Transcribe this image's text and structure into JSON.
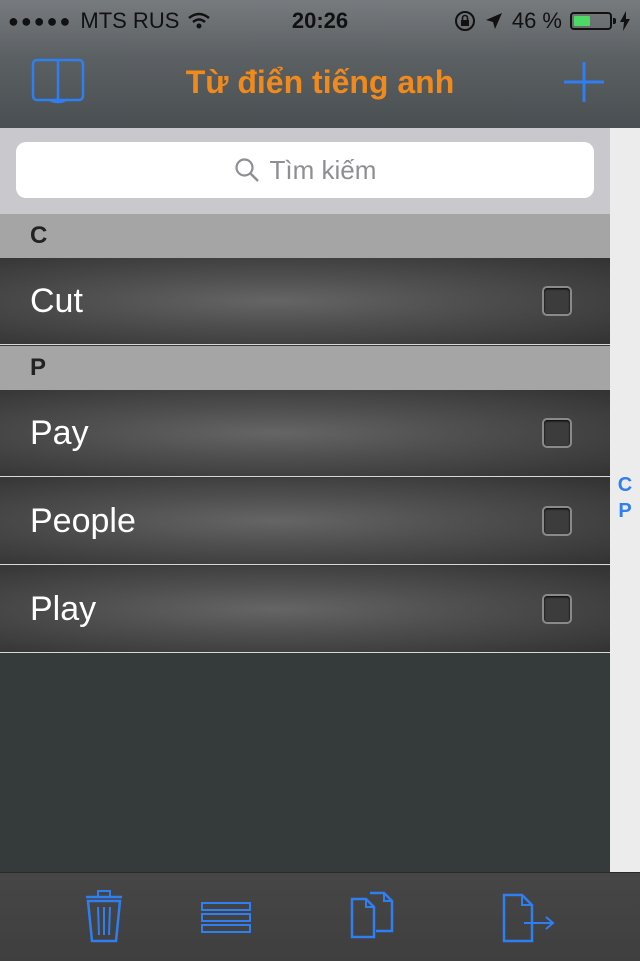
{
  "status_bar": {
    "signal": "●●●●●",
    "carrier": "MTS RUS",
    "time": "20:26",
    "battery_percent": "46 %",
    "battery_level": 0.46
  },
  "nav": {
    "title": "Từ điển tiếng anh",
    "left_icon": "book-icon",
    "right_icon": "plus-icon"
  },
  "search": {
    "placeholder": "Tìm kiếm"
  },
  "sections": [
    {
      "letter": "C",
      "items": [
        "Cut"
      ]
    },
    {
      "letter": "P",
      "items": [
        "Pay",
        "People",
        "Play"
      ]
    }
  ],
  "index": [
    "C",
    "P"
  ],
  "toolbar": {
    "icons": [
      "trash-icon",
      "list-icon",
      "copy-icon",
      "export-icon"
    ]
  },
  "colors": {
    "accent_blue": "#2f7ef2",
    "title_orange": "#f08a1c"
  }
}
